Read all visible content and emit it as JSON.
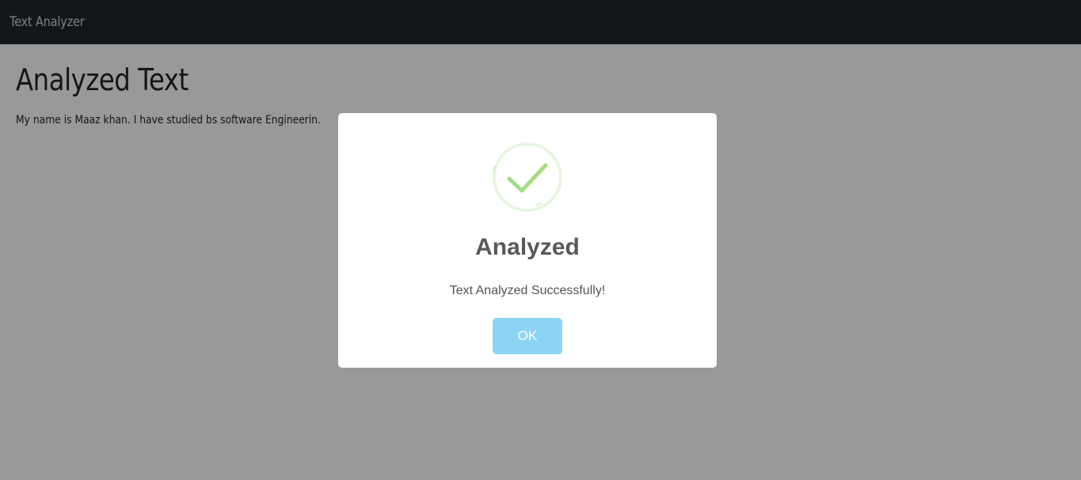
{
  "navbar": {
    "brand": "Text Analyzer"
  },
  "main": {
    "title": "Analyzed Text",
    "text": "My name is Maaz khan. I have studied bs software Engineerin."
  },
  "modal": {
    "icon": "success-check-icon",
    "title": "Analyzed",
    "message": "Text Analyzed Successfully!",
    "ok_label": "OK"
  },
  "colors": {
    "navbar_bg": "#212529",
    "overlay": "rgba(0,0,0,0.4)",
    "success_green": "#a5dc86",
    "button_blue": "#8cd4f5"
  }
}
